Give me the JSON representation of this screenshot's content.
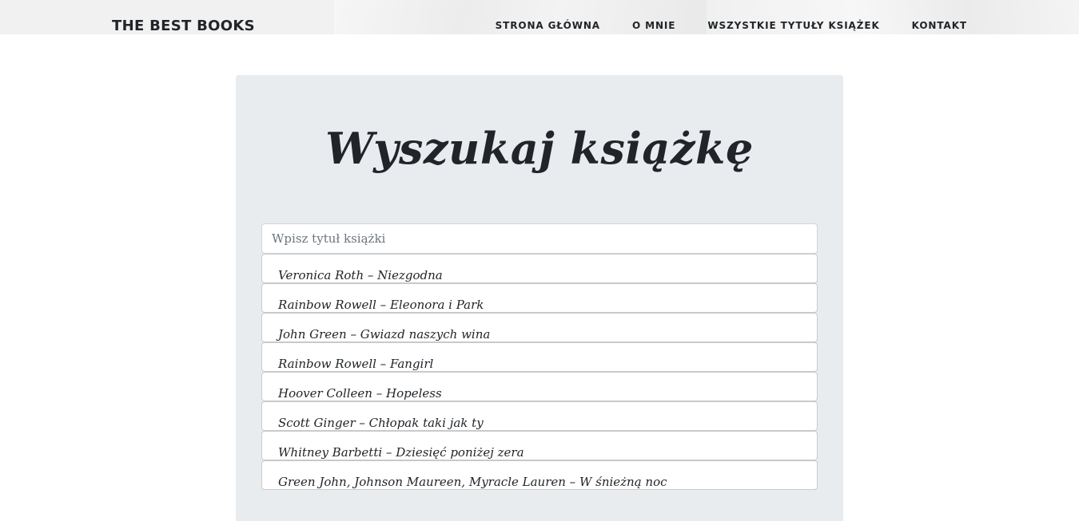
{
  "header": {
    "brand": "THE BEST BOOKS",
    "nav": [
      {
        "label": "STRONA GŁÓWNA"
      },
      {
        "label": "O MNIE"
      },
      {
        "label": "WSZYSTKIE TYTUŁY KSIĄŻEK"
      },
      {
        "label": "KONTAKT"
      }
    ]
  },
  "search": {
    "title": "Wyszukaj książkę",
    "placeholder": "Wpisz tytuł książki",
    "value": "",
    "results": [
      {
        "label": "Veronica Roth – Niezgodna"
      },
      {
        "label": "Rainbow Rowell – Eleonora i Park"
      },
      {
        "label": "John Green – Gwiazd naszych wina"
      },
      {
        "label": "Rainbow Rowell – Fangirl"
      },
      {
        "label": "Hoover Colleen – Hopeless"
      },
      {
        "label": "Scott Ginger – Chłopak taki jak ty"
      },
      {
        "label": "Whitney Barbetti – Dziesięć poniżej zera"
      },
      {
        "label": "Green John, Johnson Maureen, Myracle Lauren – W śnieżną noc"
      }
    ]
  },
  "colors": {
    "panel_bg": "#e9ecef",
    "topbar_bg": "#f1f1f1",
    "text": "#212529"
  }
}
